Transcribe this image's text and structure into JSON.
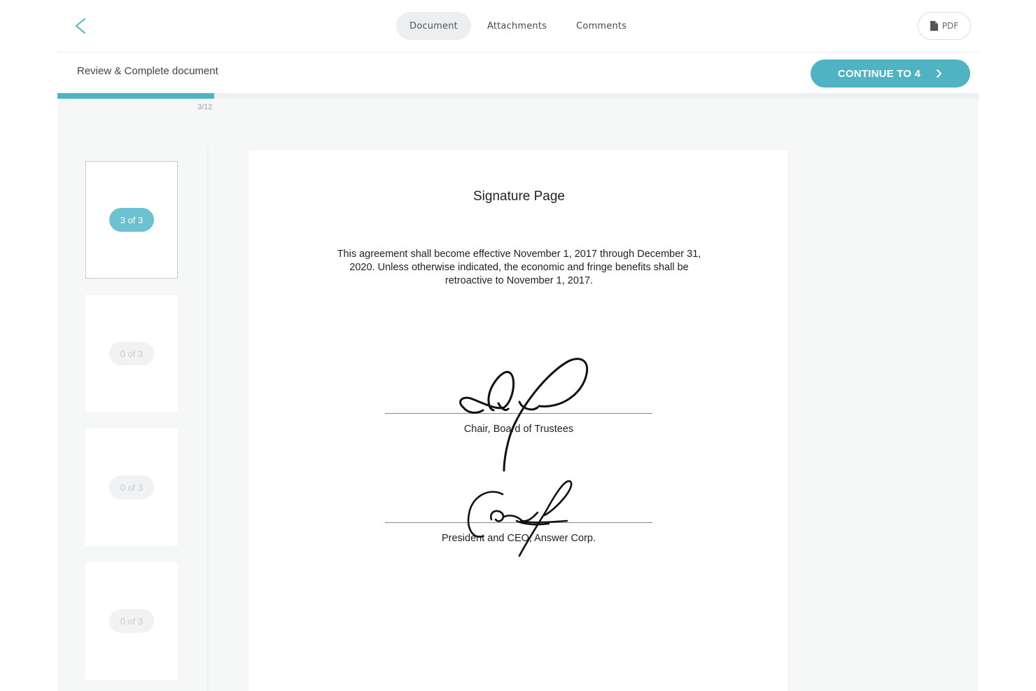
{
  "nav": {
    "back_icon": "chevron-left-icon",
    "tabs": [
      {
        "label": "Document",
        "active": true
      },
      {
        "label": "Attachments",
        "active": false
      },
      {
        "label": "Comments",
        "active": false
      }
    ],
    "pdf_label": "PDF",
    "pdf_icon": "file-icon"
  },
  "header": {
    "title": "Review & Complete document",
    "continue_label": "CONTINUE TO 4",
    "continue_icon": "chevron-right-icon"
  },
  "progress": {
    "label": "3/12",
    "value": 0.17
  },
  "thumbnails": [
    {
      "badge": "3 of 3",
      "active": true
    },
    {
      "badge": "0 of 3",
      "active": false
    },
    {
      "badge": "0 of 3",
      "active": false
    },
    {
      "badge": "0 of 3",
      "active": false
    }
  ],
  "document": {
    "title": "Signature Page",
    "body": "This agreement shall become effective November 1, 2017 through December 31, 2020. Unless otherwise indicated, the economic and fringe benefits shall be retroactive to November 1, 2017.",
    "signatures": [
      {
        "caption": "Chair, Board of Trustees"
      },
      {
        "caption": "President and CEO, Answer Corp."
      }
    ]
  },
  "colors": {
    "accent": "#4fb3c4",
    "badge_active": "#6cc2d1",
    "background": "#f6f7f7"
  }
}
